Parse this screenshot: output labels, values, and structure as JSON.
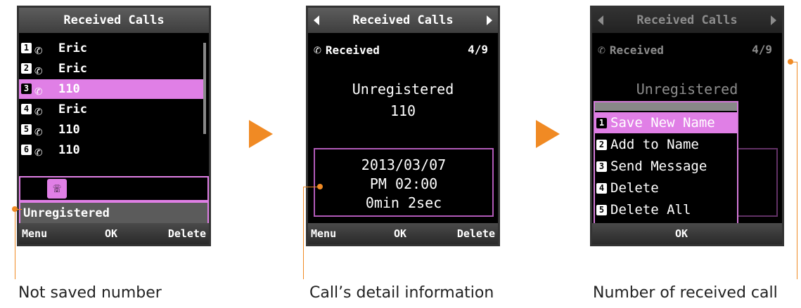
{
  "screen1": {
    "title": "Received Calls",
    "rows": [
      {
        "index": "1",
        "name": "Eric",
        "icon": "received-call-icon"
      },
      {
        "index": "2",
        "name": "Eric",
        "icon": "received-call-icon"
      },
      {
        "index": "3",
        "name": "110",
        "icon": "received-call-icon",
        "selected": true
      },
      {
        "index": "4",
        "name": "Eric",
        "icon": "received-call-icon"
      },
      {
        "index": "5",
        "name": "110",
        "icon": "received-call-icon"
      },
      {
        "index": "6",
        "name": "110",
        "icon": "received-call-icon"
      }
    ],
    "preview_icon": "phone-icon",
    "preview_text": "Unregistered",
    "softkeys": {
      "left": "Menu",
      "center": "OK",
      "right": "Delete"
    }
  },
  "screen2": {
    "title": "Received Calls",
    "status_label": "Received",
    "count": "4/9",
    "caller": "Unregistered",
    "number": "110",
    "date": "2013/03/07",
    "time": "PM 02:00",
    "duration": "0min 2sec",
    "softkeys": {
      "left": "Menu",
      "center": "OK",
      "right": "Delete"
    }
  },
  "screen3": {
    "title": "Received Calls",
    "status_label": "Received",
    "count": "4/9",
    "caller": "Unregistered",
    "menu": [
      {
        "index": "1",
        "label": "Save New Name",
        "selected": true
      },
      {
        "index": "2",
        "label": "Add to Name"
      },
      {
        "index": "3",
        "label": "Send Message"
      },
      {
        "index": "4",
        "label": "Delete"
      },
      {
        "index": "5",
        "label": "Delete All"
      }
    ],
    "softkeys": {
      "center": "OK"
    }
  },
  "captions": {
    "c1": "Not saved number",
    "c2": "Call’s detail information",
    "c3": "Number of received call"
  },
  "colors": {
    "accent": "#e07fe6",
    "callout": "#f08a24"
  }
}
